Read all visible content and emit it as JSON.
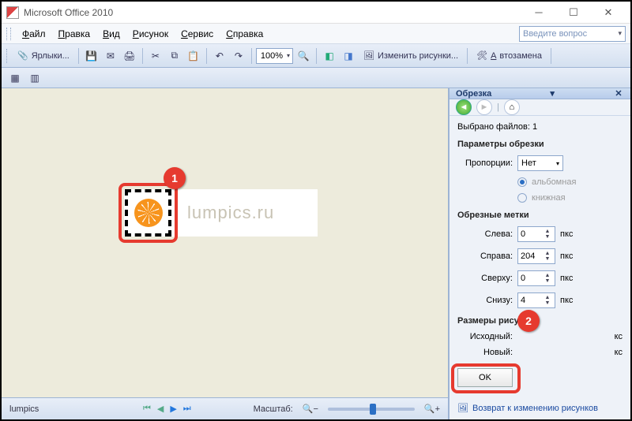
{
  "titlebar": {
    "title": "Microsoft Office 2010"
  },
  "menubar": {
    "file": "Файл",
    "edit": "Правка",
    "view": "Вид",
    "picture": "Рисунок",
    "tools": "Сервис",
    "help": "Справка",
    "ask_placeholder": "Введите вопрос"
  },
  "toolbar": {
    "shortcuts": "Ярлыки...",
    "zoom_value": "100%",
    "edit_pictures": "Изменить рисунки...",
    "autocorrect": "Автозамена"
  },
  "canvas": {
    "watermark": "lumpics.ru"
  },
  "statusbar": {
    "filename": "lumpics",
    "zoom_label": "Масштаб:"
  },
  "sidepanel": {
    "title": "Обрезка",
    "selected_files": "Выбрано файлов: 1",
    "crop_params_title": "Параметры обрезки",
    "aspect_label": "Пропорции:",
    "aspect_value": "Нет",
    "orientation_landscape": "альбомная",
    "orientation_portrait": "книжная",
    "crop_marks_title": "Обрезные метки",
    "left_label": "Слева:",
    "left_value": "0",
    "right_label": "Справа:",
    "right_value": "204",
    "top_label": "Сверху:",
    "top_value": "0",
    "bottom_label": "Снизу:",
    "bottom_value": "4",
    "unit": "пкс",
    "size_title": "Размеры рисунка",
    "original_label": "Исходный:",
    "new_label": "Новый:",
    "original_dims": "кс",
    "new_dims": "кс",
    "ok": "OK",
    "back_link": "Возврат к изменению рисунков"
  },
  "annotations": {
    "badge1": "1",
    "badge2": "2"
  }
}
